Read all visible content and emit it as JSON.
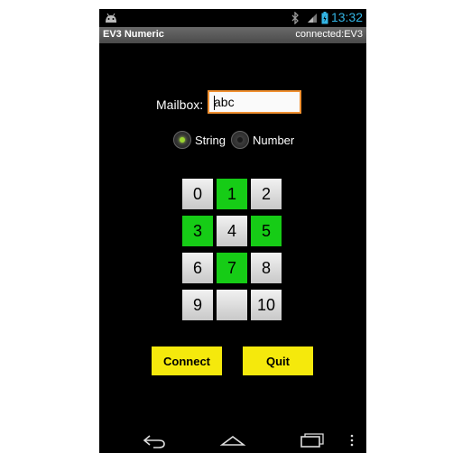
{
  "status_bar": {
    "time": "13:32",
    "icons": [
      "android-debug-icon",
      "bluetooth-icon",
      "signal-icon",
      "battery-icon"
    ]
  },
  "title_bar": {
    "app_title": "EV3 Numeric",
    "connection_status": "connected:EV3"
  },
  "mailbox": {
    "label": "Mailbox:",
    "value": "abc"
  },
  "radio_group": {
    "options": [
      {
        "label": "String",
        "checked": true
      },
      {
        "label": "Number",
        "checked": false
      }
    ]
  },
  "keypad": {
    "keys": [
      {
        "label": "0",
        "color": "grey"
      },
      {
        "label": "1",
        "color": "green"
      },
      {
        "label": "2",
        "color": "grey"
      },
      {
        "label": "3",
        "color": "green"
      },
      {
        "label": "4",
        "color": "grey"
      },
      {
        "label": "5",
        "color": "green"
      },
      {
        "label": "6",
        "color": "grey"
      },
      {
        "label": "7",
        "color": "green"
      },
      {
        "label": "8",
        "color": "grey"
      },
      {
        "label": "9",
        "color": "grey"
      },
      {
        "label": "",
        "color": "grey"
      },
      {
        "label": "10",
        "color": "grey"
      }
    ],
    "colors": {
      "green": "#16cc16",
      "grey": "#e0e0e0"
    }
  },
  "buttons": {
    "connect": "Connect",
    "quit": "Quit",
    "color": "#f5e90c"
  },
  "nav_bar": {
    "icons": [
      "back-icon",
      "home-icon",
      "recent-apps-icon",
      "overflow-menu-icon"
    ]
  }
}
